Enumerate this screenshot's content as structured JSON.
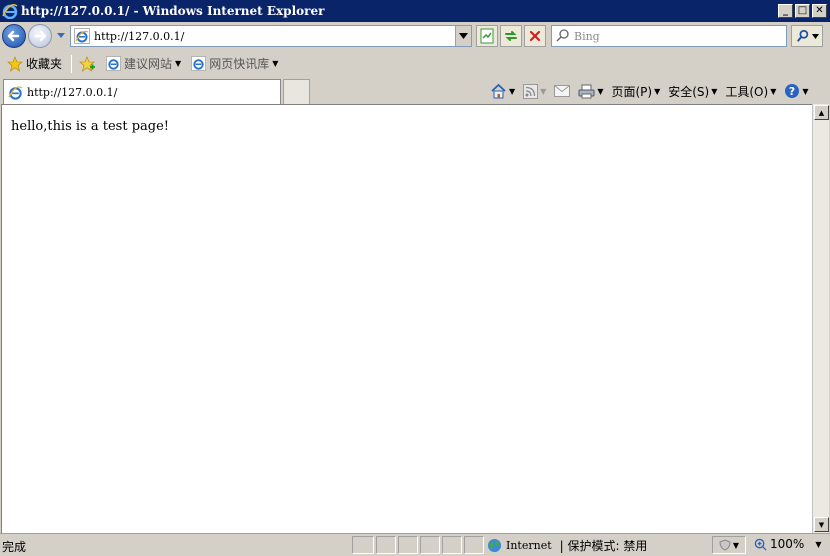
{
  "window": {
    "title": "http://127.0.0.1/ - Windows Internet Explorer",
    "minimize": "_",
    "maximize": "□",
    "close": "✕"
  },
  "nav": {
    "address": "http://127.0.0.1/",
    "search_placeholder": "Bing"
  },
  "favorites": {
    "label": "收藏夹",
    "items": [
      {
        "label": "建议网站"
      },
      {
        "label": "网页快讯库"
      }
    ]
  },
  "tab": {
    "title": "http://127.0.0.1/"
  },
  "commands": {
    "page": "页面(P)",
    "safety": "安全(S)",
    "tools": "工具(O)"
  },
  "page": {
    "text": "hello,this is a test page!"
  },
  "status": {
    "text": "完成",
    "zone": "Internet",
    "protected_mode": "| 保护模式: 禁用",
    "zoom": "100%"
  },
  "colors": {
    "title_bar": "#0a246a",
    "chrome": "#d4d0c8",
    "accent_blue": "#1e4fa8"
  },
  "icons": [
    "ie-logo-icon",
    "back-arrow-icon",
    "forward-arrow-icon",
    "compatibility-icon",
    "refresh-icon",
    "stop-icon",
    "search-icon",
    "star-icon",
    "add-favorites-icon",
    "home-icon",
    "feeds-icon",
    "mail-icon",
    "print-icon",
    "help-icon",
    "globe-icon",
    "zoom-icon"
  ]
}
